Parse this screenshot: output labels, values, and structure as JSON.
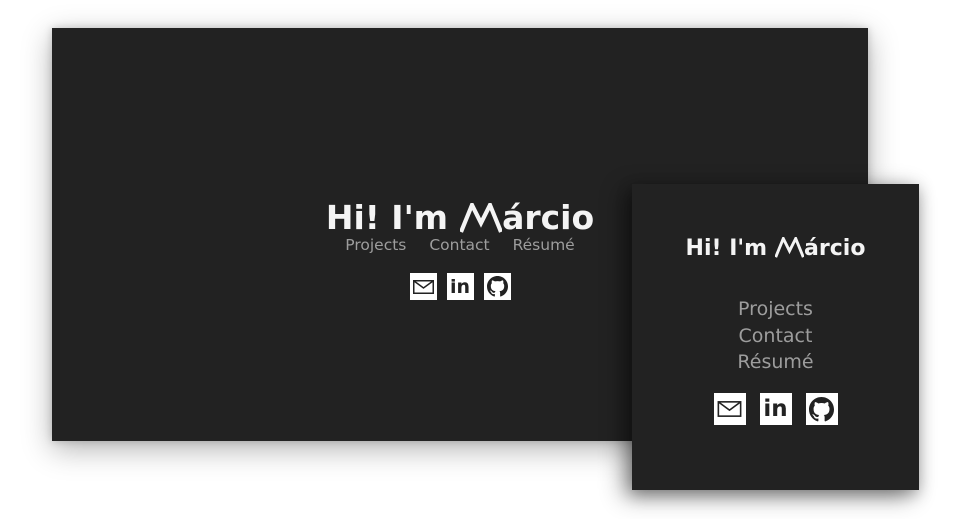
{
  "hero": {
    "greeting": "Hi! I'm",
    "name_suffix": "árcio",
    "logo_letter": "M"
  },
  "nav": {
    "items": [
      {
        "label": "Projects"
      },
      {
        "label": "Contact"
      },
      {
        "label": "Résumé"
      }
    ]
  },
  "social": {
    "items": [
      {
        "icon": "mail-icon",
        "name": "email"
      },
      {
        "icon": "linkedin-icon",
        "name": "linkedin",
        "text": "in"
      },
      {
        "icon": "github-icon",
        "name": "github"
      }
    ]
  },
  "colors": {
    "background": "#222222",
    "title": "#f4f4f4",
    "nav": "#9d9d9d",
    "icon_bg": "#ffffff"
  }
}
